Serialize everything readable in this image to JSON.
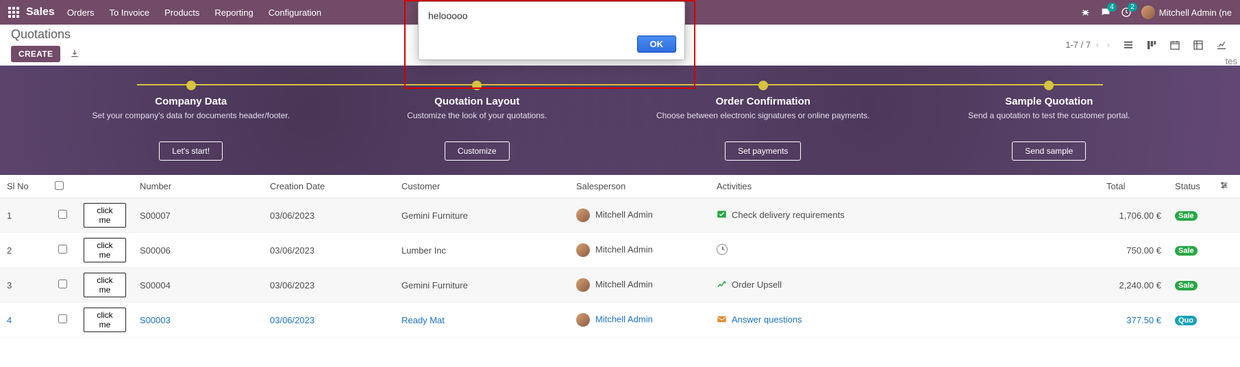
{
  "nav": {
    "brand": "Sales",
    "items": [
      "Orders",
      "To Invoice",
      "Products",
      "Reporting",
      "Configuration"
    ],
    "msg_badge": "4",
    "clock_badge": "2",
    "user": "Mitchell Admin (ne"
  },
  "control": {
    "title": "Quotations",
    "create": "CREATE",
    "pager": "1-7 / 7"
  },
  "hero": {
    "steps": [
      {
        "title": "Company Data",
        "desc": "Set your company's data for documents header/footer.",
        "btn": "Let's start!"
      },
      {
        "title": "Quotation Layout",
        "desc": "Customize the look of your quotations.",
        "btn": "Customize"
      },
      {
        "title": "Order Confirmation",
        "desc": "Choose between electronic signatures or online payments.",
        "btn": "Set payments"
      },
      {
        "title": "Sample Quotation",
        "desc": "Send a quotation to test the customer portal.",
        "btn": "Send sample"
      }
    ]
  },
  "table": {
    "headers": {
      "slno": "Sl No",
      "number": "Number",
      "cdate": "Creation Date",
      "cust": "Customer",
      "sales": "Salesperson",
      "act": "Activities",
      "total": "Total",
      "status": "Status"
    },
    "clickme": "click me",
    "rows": [
      {
        "sl": "1",
        "num": "S00007",
        "date": "03/06/2023",
        "cust": "Gemini Furniture",
        "sales": "Mitchell Admin",
        "act": "Check delivery requirements",
        "act_type": "task",
        "total": "1,706.00 €",
        "status": "Sale",
        "link": false
      },
      {
        "sl": "2",
        "num": "S00006",
        "date": "03/06/2023",
        "cust": "Lumber Inc",
        "sales": "Mitchell Admin",
        "act": "",
        "act_type": "clock",
        "total": "750.00 €",
        "status": "Sale",
        "link": false
      },
      {
        "sl": "3",
        "num": "S00004",
        "date": "03/06/2023",
        "cust": "Gemini Furniture",
        "sales": "Mitchell Admin",
        "act": "Order Upsell",
        "act_type": "chart",
        "total": "2,240.00 €",
        "status": "Sale",
        "link": false
      },
      {
        "sl": "4",
        "num": "S00003",
        "date": "03/06/2023",
        "cust": "Ready Mat",
        "sales": "Mitchell Admin",
        "act": "Answer questions",
        "act_type": "mail",
        "total": "377.50 €",
        "status": "Quo",
        "link": true
      }
    ]
  },
  "modal": {
    "text": "helooooo",
    "ok": "OK"
  },
  "float": "tes"
}
